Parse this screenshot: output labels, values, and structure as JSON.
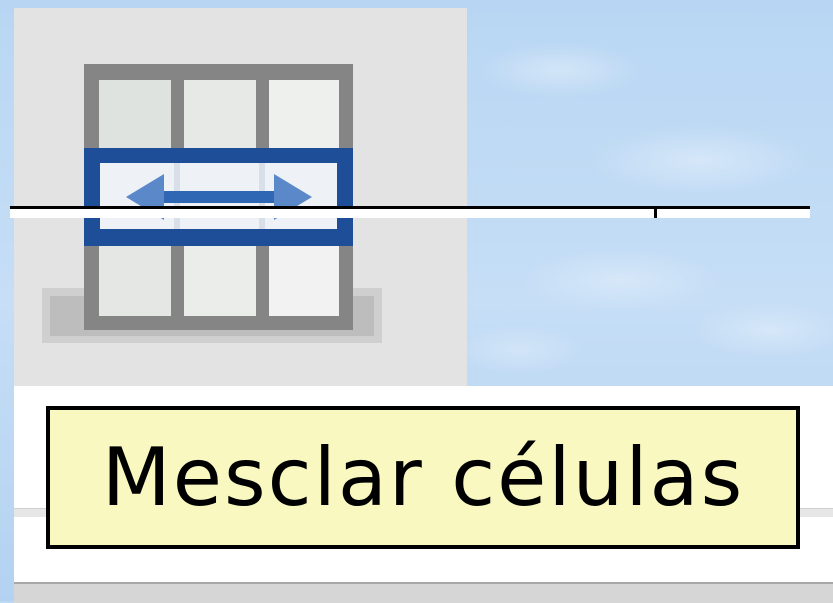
{
  "toolbar": {
    "merge_button": {
      "icon": "merge-cells-icon",
      "tooltip": "Mesclar células"
    }
  },
  "colors": {
    "tooltip_background": "#f8f8c0",
    "button_background": "#e3e3e3",
    "icon_accent": "#1f4e99",
    "icon_arrow": "#5a88c8",
    "desktop": "#bcd9f4"
  }
}
